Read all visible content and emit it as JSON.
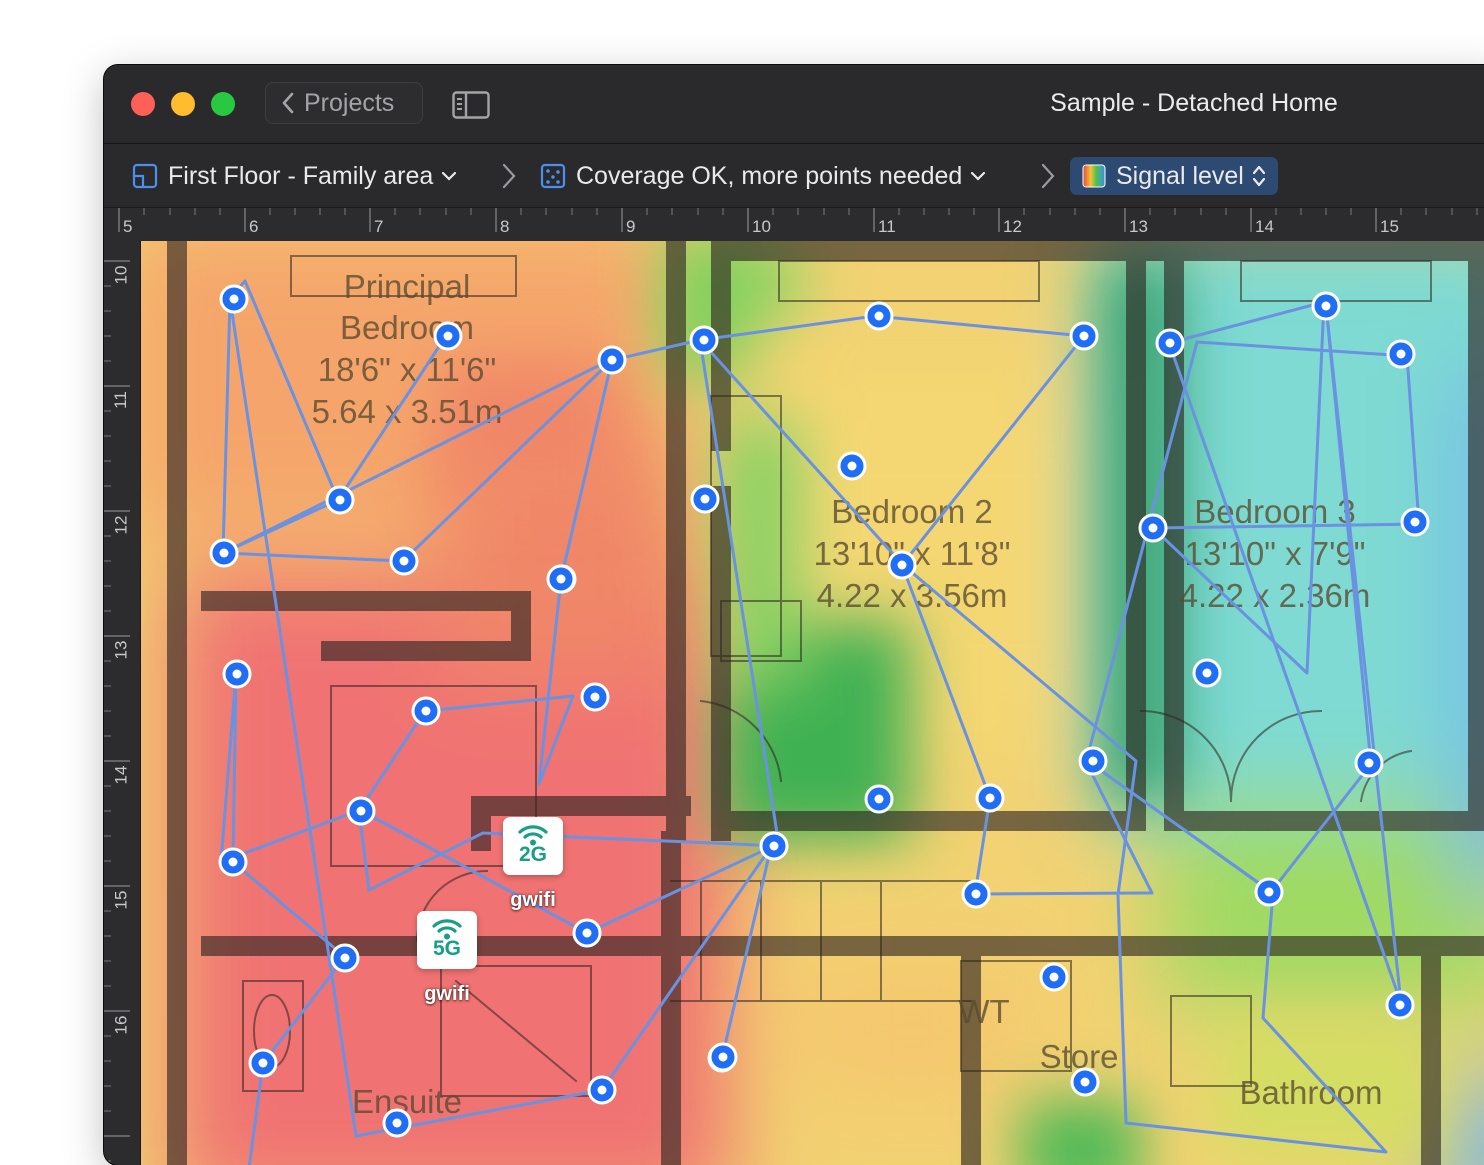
{
  "window": {
    "title": "Sample - Detached Home",
    "back_button_label": "Projects",
    "traffic_light_colors": [
      "#fe5f57",
      "#febc2e",
      "#28c840"
    ]
  },
  "breadcrumbs": [
    {
      "label": "First Floor - Family area",
      "icon": "floor-plan-icon"
    },
    {
      "label": "Coverage OK, more points needed",
      "icon": "survey-points-icon"
    },
    {
      "label": "Signal level",
      "icon": "heatmap-icon"
    }
  ],
  "ruler": {
    "horizontal_ticks": [
      "5",
      "6",
      "7",
      "8",
      "9",
      "10",
      "11",
      "12",
      "13",
      "14",
      "15"
    ],
    "vertical_ticks": [
      "10",
      "11",
      "12",
      "13",
      "14",
      "15",
      "16"
    ]
  },
  "rooms": [
    {
      "name_lines": [
        "Principal",
        "Bedroom"
      ],
      "dimensions_imperial": "18'6\" x 11'6\"",
      "dimensions_metric": "5.64 x 3.51m"
    },
    {
      "name_lines": [
        "Bedroom 2"
      ],
      "dimensions_imperial": "13'10\" x 11'8\"",
      "dimensions_metric": "4.22 x 3.56m"
    },
    {
      "name_lines": [
        "Bedroom 3"
      ],
      "dimensions_imperial": "13'10\" x 7'9\"",
      "dimensions_metric": "4.22 x 2.36m"
    },
    {
      "name_lines": [
        "Ensuite"
      ]
    },
    {
      "name_lines": [
        "Store"
      ]
    },
    {
      "name_lines": [
        "Bathroom"
      ]
    },
    {
      "name_lines": [
        "WT"
      ]
    }
  ],
  "access_points": [
    {
      "band": "2G",
      "ssid": "gwifi"
    },
    {
      "band": "5G",
      "ssid": "gwifi"
    }
  ],
  "heatmap": {
    "metric": "Signal level",
    "color_scale": [
      "#f06a6a",
      "#f5a464",
      "#f5d469",
      "#9ad254",
      "#35b04a",
      "#62d4d4",
      "#6cb4ea"
    ]
  },
  "colors": {
    "survey_point": "#1f6ef5",
    "survey_path": "#6a92e0",
    "selected_crumb_bg": "#2c4a72"
  }
}
